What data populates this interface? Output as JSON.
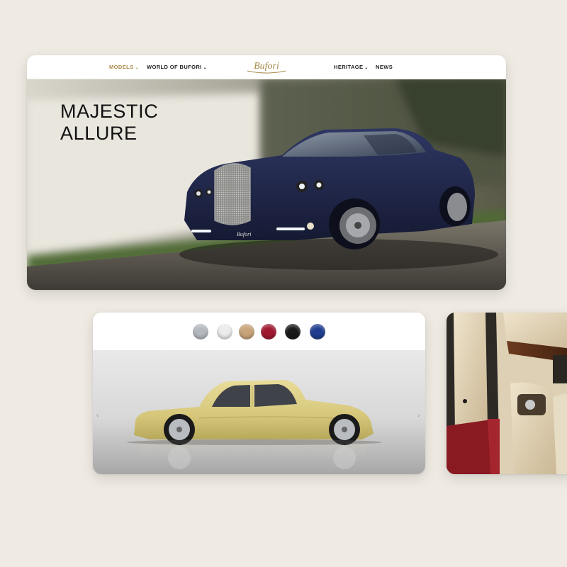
{
  "nav": {
    "models": "MODELS",
    "world": "WORLD OF BUFORI",
    "heritage": "HERITAGE",
    "news": "NEWS",
    "logo_text": "Bufori",
    "chevron": "⌄"
  },
  "hero": {
    "headline_line1": "MAJESTIC",
    "headline_line2": "ALLURE",
    "car_color": "#1c2448"
  },
  "configurator": {
    "swatches": [
      {
        "name": "silver",
        "color": "#b4b9bf"
      },
      {
        "name": "white",
        "color": "#ececec"
      },
      {
        "name": "champagne",
        "color": "#c9a47a"
      },
      {
        "name": "red",
        "color": "#a01830"
      },
      {
        "name": "black",
        "color": "#1a1a1a"
      },
      {
        "name": "blue",
        "color": "#1f3e8f"
      }
    ],
    "selected_car_color": "#ddd08a",
    "prev_arrow": "‹",
    "next_arrow": "›"
  },
  "colors": {
    "accent_gold": "#a88a4a",
    "page_background": "#efebe3"
  }
}
